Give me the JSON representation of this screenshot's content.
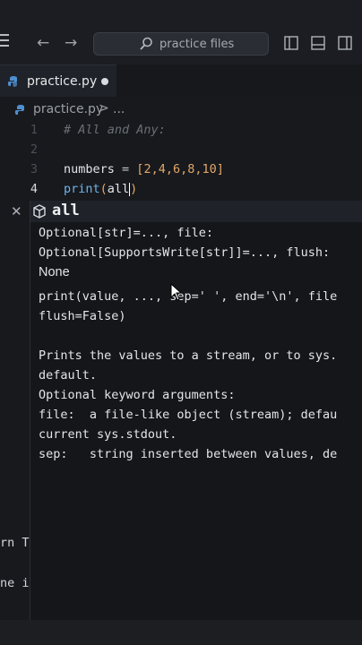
{
  "titlebar": {
    "search_placeholder": "practice files",
    "back_icon": "arrow-left-icon",
    "forward_icon": "arrow-right-icon"
  },
  "tab": {
    "label": "practice.py",
    "modified": true
  },
  "breadcrumb": {
    "file": "practice.py",
    "separator": ">",
    "more": "..."
  },
  "editor": {
    "line_numbers": [
      "1",
      "2",
      "3",
      "4"
    ],
    "line1_comment": "# All and Any:",
    "line3": {
      "var": "numbers",
      "op": " = ",
      "open": "[",
      "values": "2,4,6,8,10",
      "close": "]"
    },
    "line4": {
      "fn": "print",
      "open": "(",
      "arg": "all",
      "close": ")"
    }
  },
  "hover": {
    "title": "all",
    "sig_lines": [
      "Optional[str]=..., file:",
      "Optional[SupportsWrite[str]]=..., flush:",
      "None"
    ],
    "call_lines": [
      "print(value, ..., sep=' ', end='\\n', file",
      "flush=False)"
    ],
    "desc_lines": [
      "Prints the values to a stream, or to sys.",
      "default.",
      "Optional keyword arguments:",
      "file:  a file-like object (stream); defau",
      "current sys.stdout.",
      "sep:   string inserted between values, de"
    ]
  },
  "residual_text": [
    "rn T",
    "ne i"
  ]
}
